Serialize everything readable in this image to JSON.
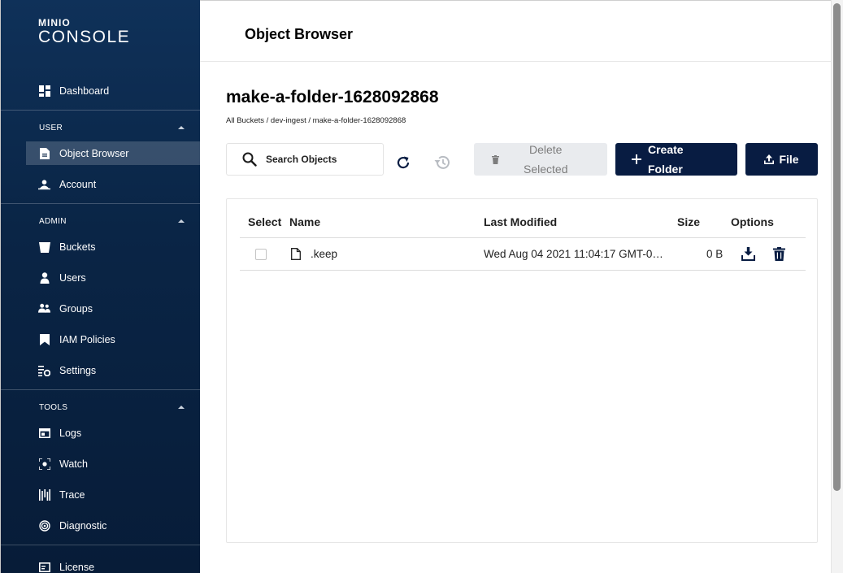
{
  "logo": {
    "min": "MINIO",
    "console": "CONSOLE"
  },
  "sidebar": {
    "dashboard": "Dashboard",
    "sections": {
      "user": "USER",
      "admin": "ADMIN",
      "tools": "TOOLS"
    },
    "user_items": [
      "Object Browser",
      "Account"
    ],
    "admin_items": [
      "Buckets",
      "Users",
      "Groups",
      "IAM Policies",
      "Settings"
    ],
    "tools_items": [
      "Logs",
      "Watch",
      "Trace",
      "Diagnostic"
    ],
    "license": "License"
  },
  "header": {
    "title": "Object Browser"
  },
  "bucket": {
    "title": "make-a-folder-1628092868",
    "breadcrumb": "All Buckets / dev-ingest / make-a-folder-1628092868"
  },
  "toolbar": {
    "search_placeholder": "Search Objects",
    "delete_line1": "Delete",
    "delete_line2": "Selected",
    "create_line1": "Create",
    "create_line2": "Folder",
    "upload_label": "File"
  },
  "table": {
    "headers": {
      "select": "Select",
      "name": "Name",
      "modified": "Last Modified",
      "size": "Size",
      "options": "Options"
    },
    "rows": [
      {
        "name": ".keep",
        "modified": "Wed Aug 04 2021 11:04:17 GMT-0…",
        "size": "0 B"
      }
    ]
  },
  "colors": {
    "sidebar": "#0a2546",
    "primary_button": "#081c42",
    "disabled_button": "#e9ebee"
  }
}
